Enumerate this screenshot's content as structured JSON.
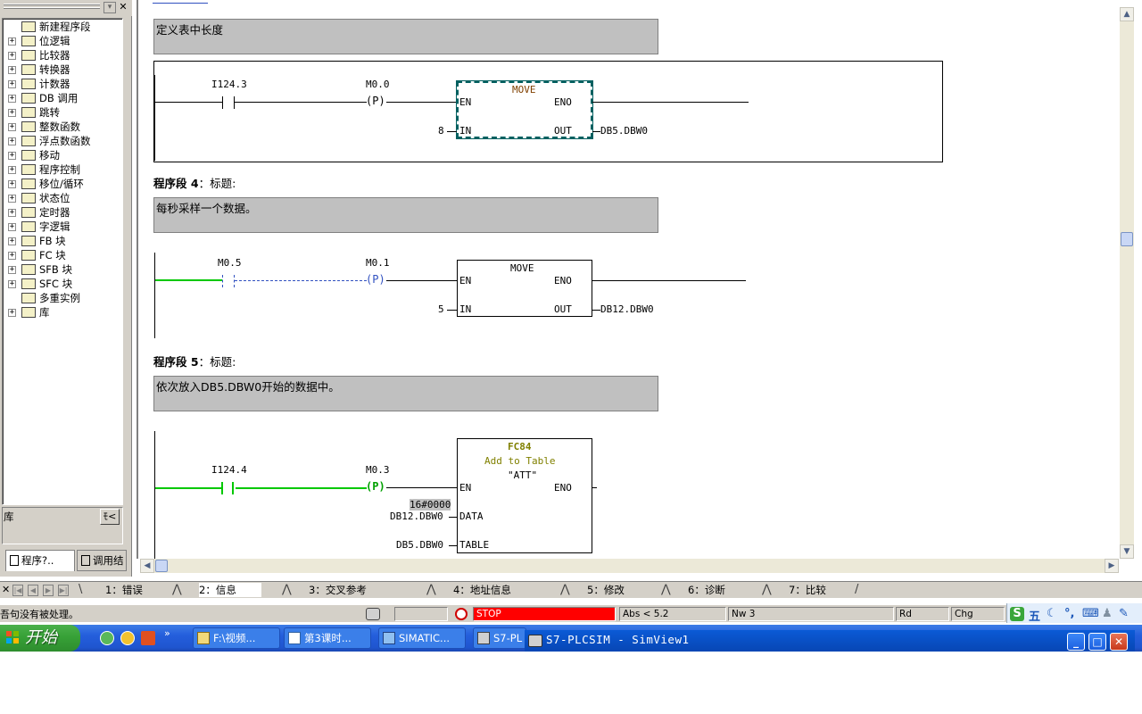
{
  "catalog": {
    "items": [
      {
        "label": "新建程序段",
        "icon": "new-network-icon",
        "expandable": false
      },
      {
        "label": "位逻辑",
        "icon": "bit-logic-icon",
        "expandable": true
      },
      {
        "label": "比较器",
        "icon": "comparator-icon",
        "expandable": true
      },
      {
        "label": "转换器",
        "icon": "converter-icon",
        "expandable": true
      },
      {
        "label": "计数器",
        "icon": "counter-icon",
        "expandable": true
      },
      {
        "label": "DB 调用",
        "icon": "db-call-icon",
        "expandable": true
      },
      {
        "label": "跳转",
        "icon": "jump-icon",
        "expandable": true
      },
      {
        "label": "整数函数",
        "icon": "integer-function-icon",
        "expandable": true
      },
      {
        "label": "浮点数函数",
        "icon": "float-function-icon",
        "expandable": true
      },
      {
        "label": "移动",
        "icon": "move-icon",
        "expandable": true
      },
      {
        "label": "程序控制",
        "icon": "program-control-icon",
        "expandable": true
      },
      {
        "label": "移位/循环",
        "icon": "shift-rotate-icon",
        "expandable": true
      },
      {
        "label": "状态位",
        "icon": "status-bit-icon",
        "expandable": true
      },
      {
        "label": "定时器",
        "icon": "timer-icon",
        "expandable": true
      },
      {
        "label": "字逻辑",
        "icon": "word-logic-icon",
        "expandable": true
      },
      {
        "label": "FB 块",
        "icon": "fb-block-icon",
        "expandable": true
      },
      {
        "label": "FC 块",
        "icon": "fc-block-icon",
        "expandable": true
      },
      {
        "label": "SFB 块",
        "icon": "sfb-block-icon",
        "expandable": true
      },
      {
        "label": "SFC 块",
        "icon": "sfc-block-icon",
        "expandable": true
      },
      {
        "label": "多重实例",
        "icon": "multi-instance-icon",
        "expandable": false
      },
      {
        "label": "库",
        "icon": "library-icon",
        "expandable": true
      }
    ],
    "lib_label": "库",
    "lib_button": "ﾓ<",
    "tabs": [
      {
        "label": "程序?..",
        "icon": "program-elements-icon"
      },
      {
        "label": "调用结",
        "icon": "call-structure-icon"
      }
    ]
  },
  "editor": {
    "network3": {
      "comment": "定义表中长度",
      "contact_addr": "I124.3",
      "coil_addr": "M0.0",
      "coil_symbol": "(P)",
      "box_title": "MOVE",
      "pin_en": "EN",
      "pin_eno": "ENO",
      "pin_in": "IN",
      "pin_out": "OUT",
      "in_value": "8",
      "out_value": "DB5.DBW0"
    },
    "network4": {
      "title_bold": "程序段 4",
      "title_rest": "：标题:",
      "comment": "每秒采样一个数据。",
      "contact_addr": "M0.5",
      "coil_addr": "M0.1",
      "coil_symbol": "(P)",
      "box_title": "MOVE",
      "pin_en": "EN",
      "pin_eno": "ENO",
      "pin_in": "IN",
      "pin_out": "OUT",
      "in_value": "5",
      "out_value": "DB12.DBW0"
    },
    "network5": {
      "title_bold": "程序段 5",
      "title_rest": "：标题:",
      "comment": "依次放入DB5.DBW0开始的数据中。",
      "contact_addr": "I124.4",
      "coil_addr": "M0.3",
      "coil_symbol": "(P)",
      "box_title": "FC84",
      "box_subtitle": "Add to Table",
      "box_symbol": "\"ATT\"",
      "pin_en": "EN",
      "pin_eno": "ENO",
      "pin_data": "DATA",
      "pin_table": "TABLE",
      "data_monitor": "16#0000",
      "data_value": "DB12.DBW0",
      "table_value": "DB5.DBW0"
    }
  },
  "bottom_tabs": [
    {
      "label": "1：错误",
      "active": false
    },
    {
      "label": "2：信息",
      "active": true
    },
    {
      "label": "3：交叉参考",
      "active": false
    },
    {
      "label": "4：地址信息",
      "active": false
    },
    {
      "label": "5：修改",
      "active": false
    },
    {
      "label": "6：诊断",
      "active": false
    },
    {
      "label": "7：比较",
      "active": false
    }
  ],
  "status_bar": {
    "message": "吾句没有被处理。",
    "cpu_state": "STOP",
    "abs": "Abs < 5.2",
    "nw": "Nw 3",
    "rd": "Rd",
    "chg": "Chg"
  },
  "taskbar": {
    "start_label": "开始",
    "tasks": [
      {
        "label": "F:\\视频...",
        "icon": "folder-icon"
      },
      {
        "label": "第3课时...",
        "icon": "document-icon"
      },
      {
        "label": "SIMATIC...",
        "icon": "simatic-icon"
      },
      {
        "label": "S7-PL",
        "icon": "plcsim-icon"
      }
    ],
    "active_window_title": "S7-PLCSIM - SimView1",
    "ime_label": "五"
  },
  "colors": {
    "rung_powered": "#00c800",
    "rung_unpowered": "#3050c0",
    "stop_field": "#ff0000",
    "fc_box_text": "#808000",
    "comment_bg": "#c0c0c0",
    "taskbar_blue": "#245edc",
    "start_green": "#37a137"
  }
}
